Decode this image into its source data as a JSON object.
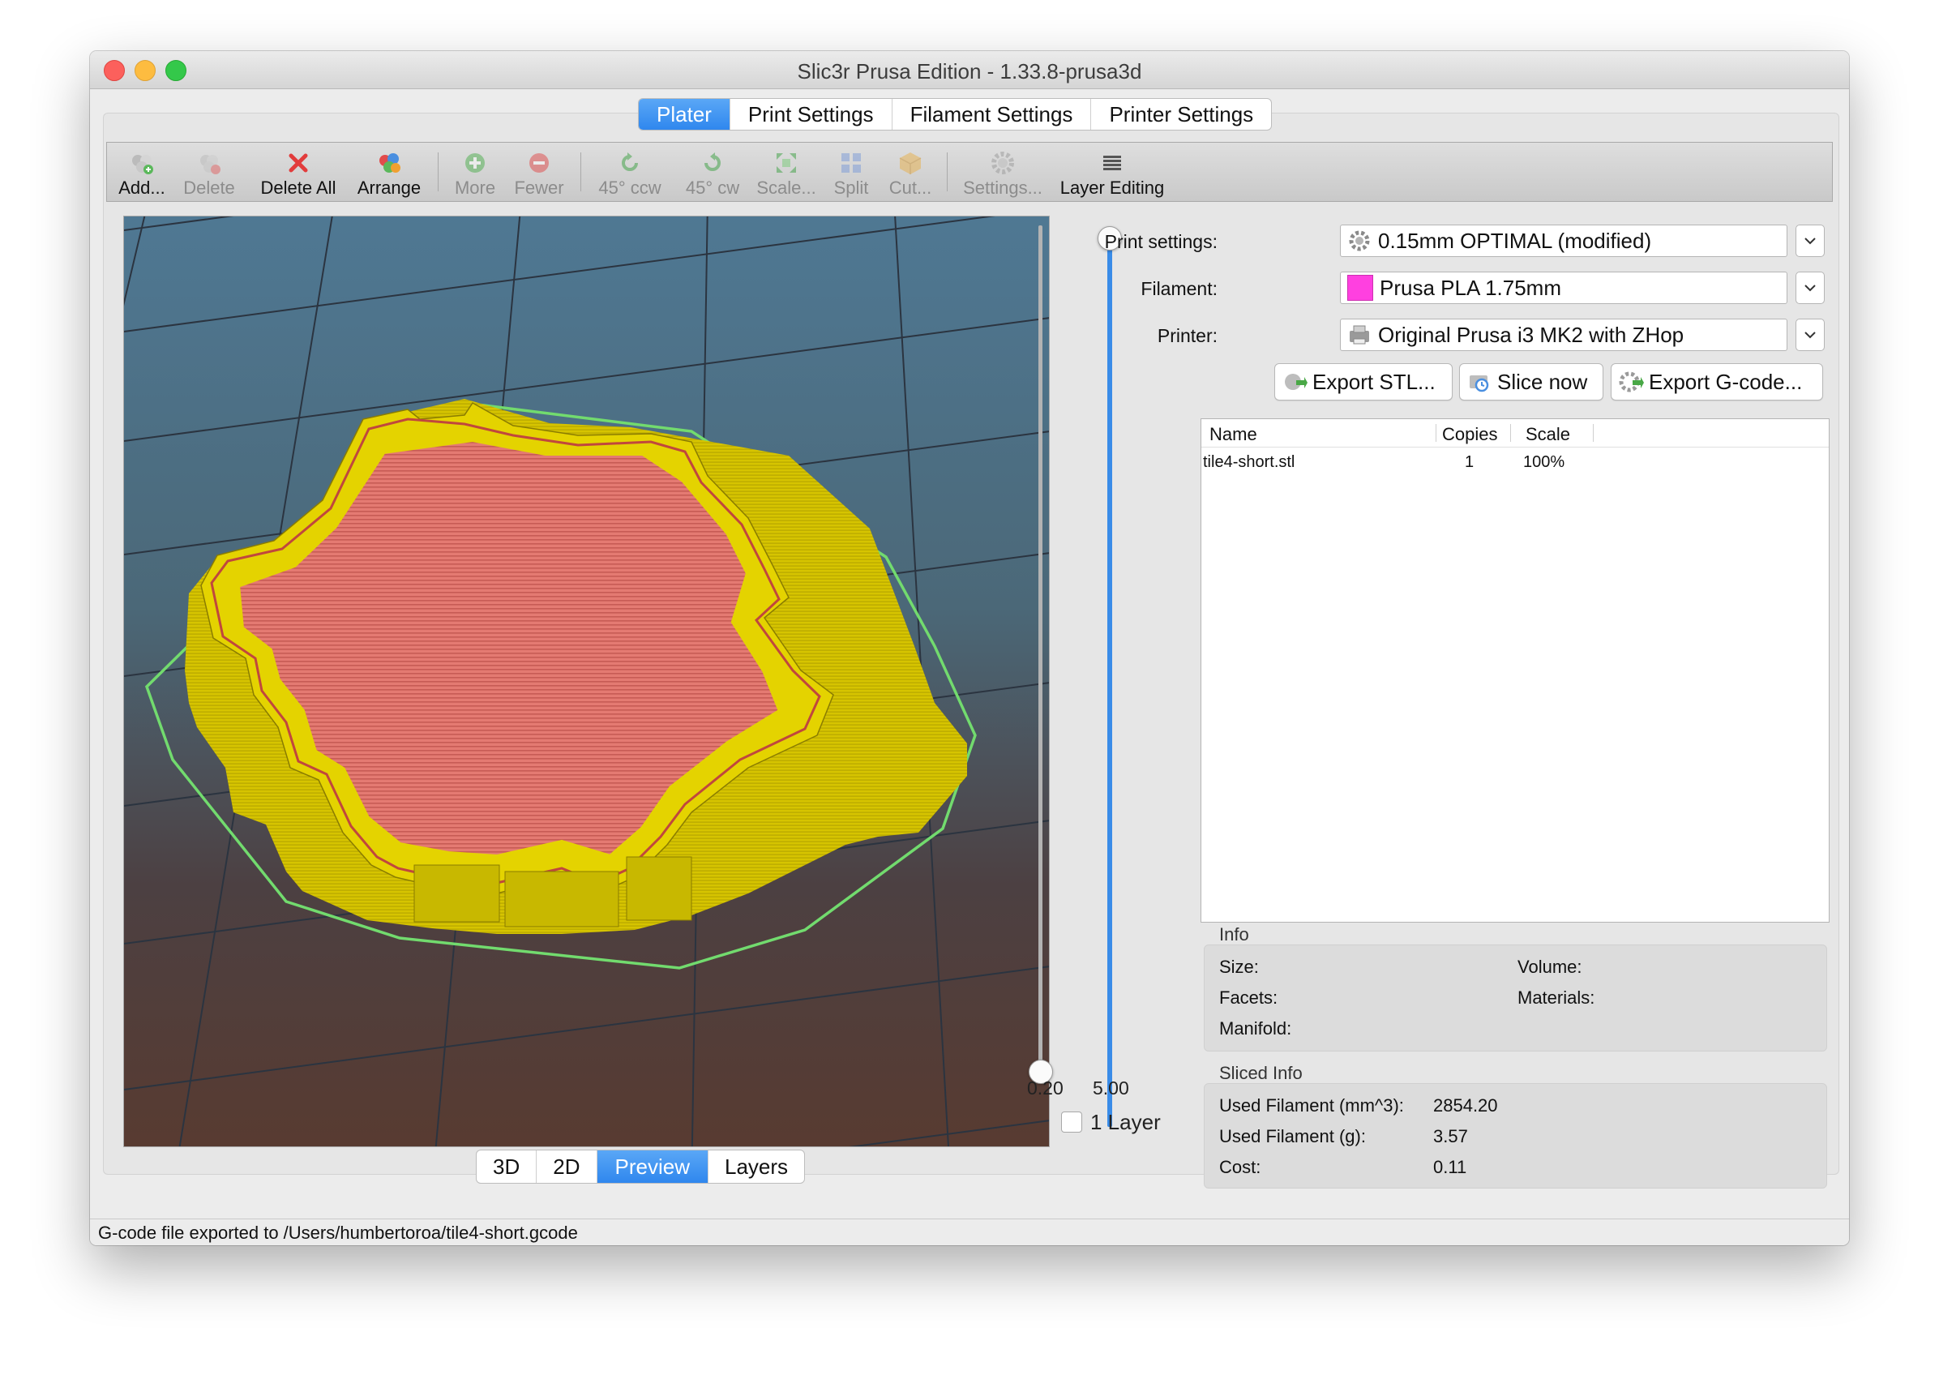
{
  "window": {
    "title": "Slic3r Prusa Edition - 1.33.8-prusa3d"
  },
  "tabs": [
    "Plater",
    "Print Settings",
    "Filament Settings",
    "Printer Settings"
  ],
  "toolbar": {
    "add": "Add...",
    "delete": "Delete",
    "delete_all": "Delete All",
    "arrange": "Arrange",
    "more": "More",
    "fewer": "Fewer",
    "rotate_ccw": "45° ccw",
    "rotate_cw": "45° cw",
    "scale": "Scale...",
    "split": "Split",
    "cut": "Cut...",
    "settings": "Settings...",
    "layer_editing": "Layer Editing"
  },
  "layer_slider": {
    "min": "0.20",
    "max": "5.00",
    "one_layer_label": "1 Layer",
    "one_layer_checked": false
  },
  "view_tabs": [
    "3D",
    "2D",
    "Preview",
    "Layers"
  ],
  "view_tab_active": "Preview",
  "print_settings": {
    "label": "Print settings:",
    "value": "0.15mm OPTIMAL (modified)"
  },
  "filament": {
    "label": "Filament:",
    "value": "Prusa PLA 1.75mm",
    "color": "#ff40e0"
  },
  "printer": {
    "label": "Printer:",
    "value": "Original Prusa i3 MK2 with ZHop"
  },
  "buttons": {
    "export_stl": "Export STL...",
    "slice_now": "Slice now",
    "export_gcode": "Export G-code..."
  },
  "object_list": {
    "columns": [
      "Name",
      "Copies",
      "Scale"
    ],
    "rows": [
      {
        "name": "tile4-short.stl",
        "copies": "1",
        "scale": "100%"
      }
    ]
  },
  "info": {
    "title": "Info",
    "size_label": "Size:",
    "volume_label": "Volume:",
    "facets_label": "Facets:",
    "materials_label": "Materials:",
    "manifold_label": "Manifold:"
  },
  "sliced_info": {
    "title": "Sliced Info",
    "used_filament_mm3_label": "Used Filament (mm^3):",
    "used_filament_mm3": "2854.20",
    "used_filament_g_label": "Used Filament (g):",
    "used_filament_g": "3.57",
    "cost_label": "Cost:",
    "cost": "0.11"
  },
  "status_bar": "G-code file exported to /Users/humbertoroa/tile4-short.gcode",
  "colors": {
    "accent": "#3a8ce8",
    "wall": "#d4c300",
    "infill": "#e26f6a",
    "skirt": "#6fd66a"
  }
}
